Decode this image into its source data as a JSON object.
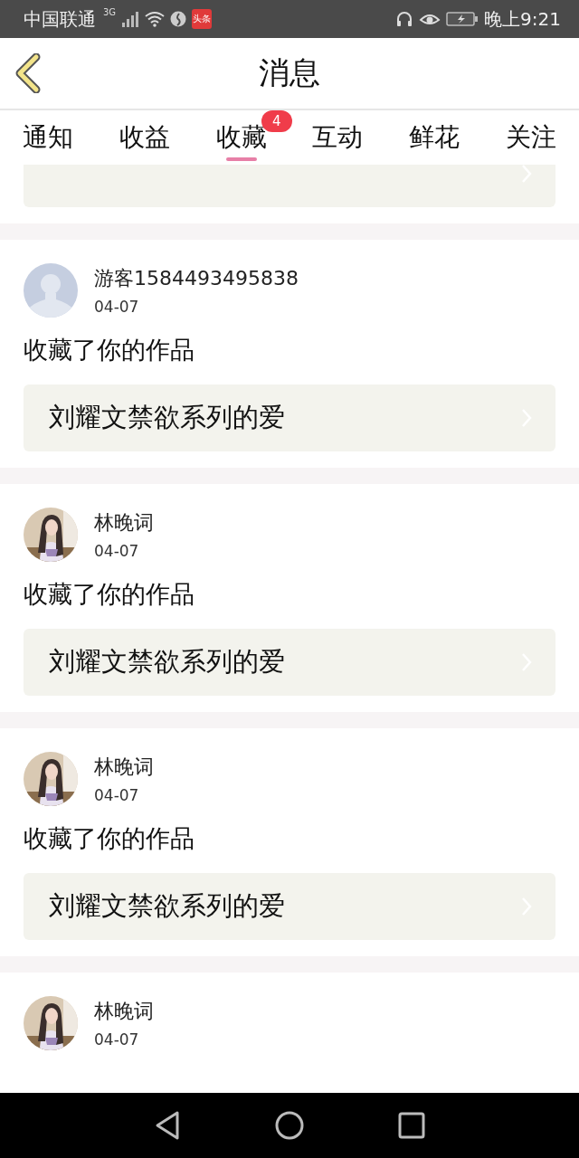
{
  "status_bar": {
    "carrier": "中国联通",
    "network": "3G",
    "app_badge": "头条",
    "time": "晚上9:21"
  },
  "header": {
    "title": "消息"
  },
  "tabs": [
    {
      "label": "通知",
      "selected": false
    },
    {
      "label": "收益",
      "selected": false
    },
    {
      "label": "收藏",
      "selected": true,
      "badge": "4"
    },
    {
      "label": "互动",
      "selected": false
    },
    {
      "label": "鲜花",
      "selected": false
    },
    {
      "label": "关注",
      "selected": false
    }
  ],
  "messages": [
    {
      "kind": "tail"
    },
    {
      "kind": "full",
      "avatar": {
        "kind": "silhouette"
      },
      "user": "游客1584493495838",
      "date": "04-07",
      "action": "收藏了你的作品",
      "book": "刘耀文禁欲系列的爱"
    },
    {
      "kind": "full",
      "user": "林晚词",
      "date": "04-07",
      "action": "收藏了你的作品",
      "book": "刘耀文禁欲系列的爱"
    },
    {
      "kind": "full",
      "user": "林晚词",
      "date": "04-07",
      "action": "收藏了你的作品",
      "book": "刘耀文禁欲系列的爱"
    },
    {
      "kind": "full",
      "user": "林晚词",
      "date": "04-07"
    }
  ]
}
